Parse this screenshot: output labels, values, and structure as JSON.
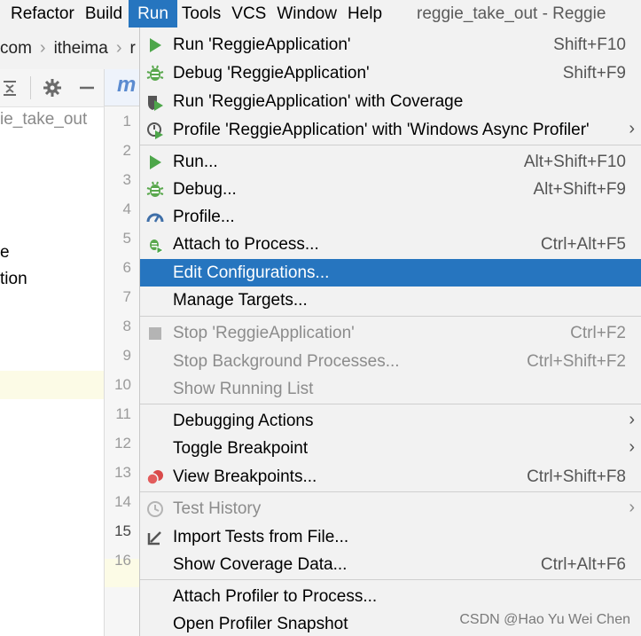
{
  "menubar": {
    "items": [
      {
        "label": "Refactor"
      },
      {
        "label": "Build"
      },
      {
        "label": "Run"
      },
      {
        "label": "Tools"
      },
      {
        "label": "VCS"
      },
      {
        "label": "Window"
      },
      {
        "label": "Help"
      }
    ],
    "window_title": "reggie_take_out - Reggie"
  },
  "navbar": {
    "crumbs": [
      "com",
      "itheima",
      "r"
    ]
  },
  "project_panel": {
    "tree": [
      "ie_take_out",
      "e",
      "tion"
    ]
  },
  "editor": {
    "tab_letter": "m",
    "line_numbers": [
      "1",
      "2",
      "3",
      "4",
      "5",
      "6",
      "7",
      "8",
      "9",
      "10",
      "11",
      "12",
      "13",
      "14",
      "15",
      "16"
    ],
    "current_line": "15"
  },
  "run_menu": {
    "items": [
      {
        "label": "Run 'ReggieApplication'",
        "shortcut": "Shift+F10",
        "icon": "run-icon"
      },
      {
        "label": "Debug 'ReggieApplication'",
        "shortcut": "Shift+F9",
        "icon": "debug-icon"
      },
      {
        "label": "Run 'ReggieApplication' with Coverage",
        "shortcut": "",
        "icon": "coverage-icon"
      },
      {
        "label": "Profile 'ReggieApplication' with 'Windows Async Profiler'",
        "shortcut": "",
        "icon": "profile-run-icon"
      },
      {
        "label": "Run...",
        "shortcut": "Alt+Shift+F10",
        "icon": "run-icon"
      },
      {
        "label": "Debug...",
        "shortcut": "Alt+Shift+F9",
        "icon": "debug-icon"
      },
      {
        "label": "Profile...",
        "shortcut": "",
        "icon": "profiler-gauge-icon"
      },
      {
        "label": "Attach to Process...",
        "shortcut": "Ctrl+Alt+F5",
        "icon": "attach-debug-icon"
      },
      {
        "label": "Edit Configurations...",
        "shortcut": "",
        "icon": ""
      },
      {
        "label": "Manage Targets...",
        "shortcut": "",
        "icon": ""
      },
      {
        "label": "Stop 'ReggieApplication'",
        "shortcut": "Ctrl+F2",
        "icon": "stop-icon"
      },
      {
        "label": "Stop Background Processes...",
        "shortcut": "Ctrl+Shift+F2",
        "icon": ""
      },
      {
        "label": "Show Running List",
        "shortcut": "",
        "icon": ""
      },
      {
        "label": "Debugging Actions",
        "shortcut": "",
        "icon": ""
      },
      {
        "label": "Toggle Breakpoint",
        "shortcut": "",
        "icon": ""
      },
      {
        "label": "View Breakpoints...",
        "shortcut": "Ctrl+Shift+F8",
        "icon": "breakpoints-icon"
      },
      {
        "label": "Test History",
        "shortcut": "",
        "icon": "history-clock-icon"
      },
      {
        "label": "Import Tests from File...",
        "shortcut": "",
        "icon": "import-arrow-icon"
      },
      {
        "label": "Show Coverage Data...",
        "shortcut": "Ctrl+Alt+F6",
        "icon": ""
      },
      {
        "label": "Attach Profiler to Process...",
        "shortcut": "",
        "icon": ""
      },
      {
        "label": "Open Profiler Snapshot",
        "shortcut": "",
        "icon": ""
      }
    ]
  },
  "colors": {
    "selection": "#2675bf",
    "run_green": "#4da64a",
    "debug_green": "#5aa84e",
    "breakpoint_red": "#d94a4a"
  },
  "watermark": "CSDN @Hao Yu Wei Chen"
}
